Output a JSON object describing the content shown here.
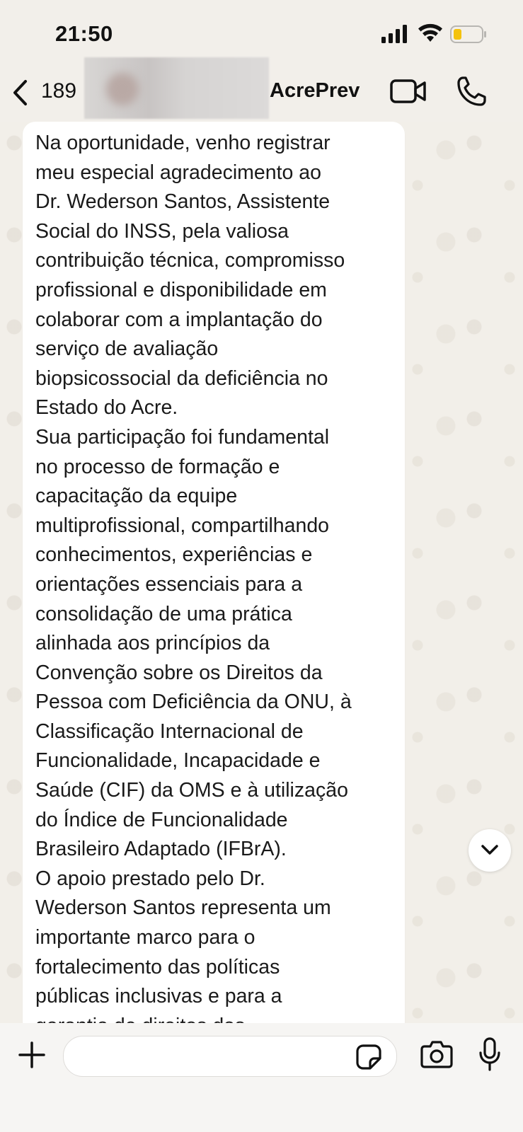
{
  "status_bar": {
    "time": "21:50",
    "battery_color": "#f4c20d"
  },
  "header": {
    "unread_count": "189",
    "contact_name": "AcrePrev"
  },
  "message": {
    "text": "Na oportunidade, venho registrar\nmeu especial agradecimento ao\nDr. Wederson Santos, Assistente\nSocial do INSS, pela valiosa\ncontribuição técnica, compromisso\nprofissional e disponibilidade em\ncolaborar com a implantação do\nserviço de avaliação\nbiopsicossocial da deficiência no\nEstado do Acre.\nSua participação foi fundamental\nno processo de formação e\ncapacitação da equipe\nmultiprofissional, compartilhando\nconhecimentos, experiências e\norientações essenciais para a\nconsolidação de uma prática\nalinhada aos princípios da\nConvenção sobre os Direitos da\nPessoa com Deficiência da ONU, à\nClassificação Internacional de\nFuncionalidade, Incapacidade e\nSaúde (CIF) da OMS e à utilização\ndo Índice de Funcionalidade\nBrasileiro Adaptado (IFBrA).\nO apoio prestado pelo Dr.\nWederson Santos representa um\nimportante marco para o\nfortalecimento das políticas\npúblicas inclusivas e para a\ngarantia de direitos das"
  },
  "composer": {
    "input_value": "",
    "input_placeholder": ""
  },
  "colors": {
    "background": "#f2efea",
    "bubble": "#ffffff",
    "icon": "#111111"
  }
}
